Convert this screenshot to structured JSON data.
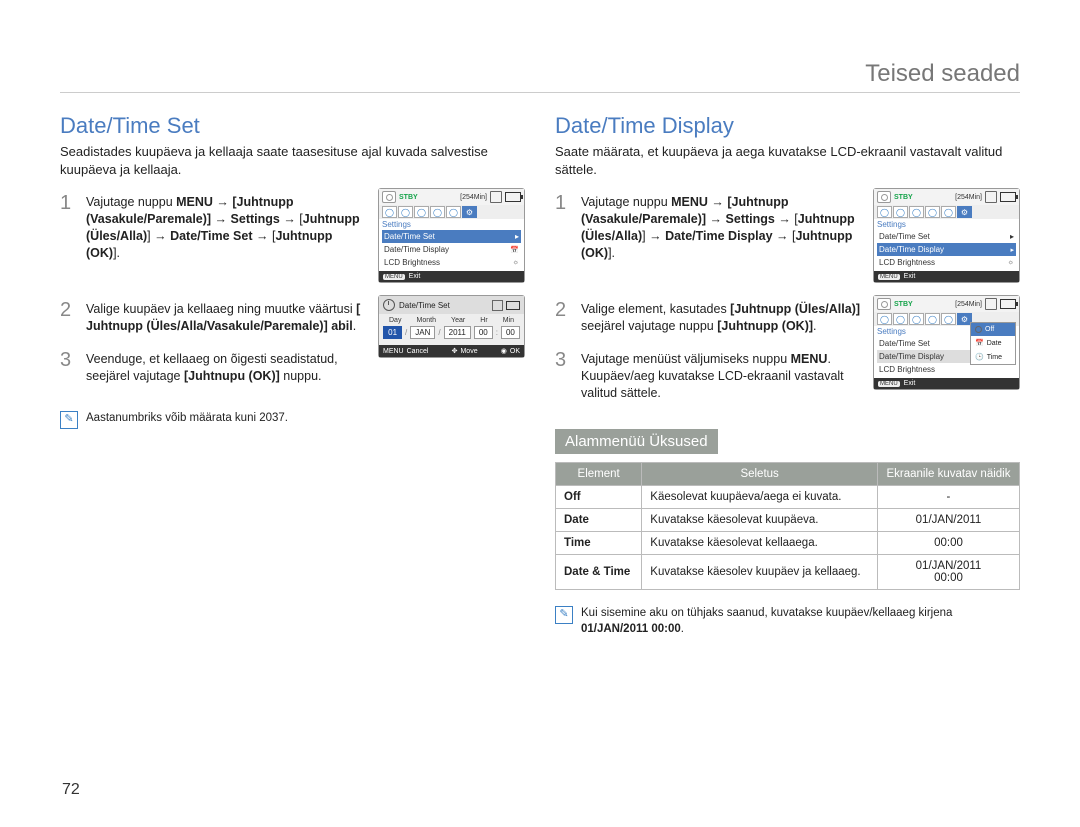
{
  "page": {
    "header": "Teised seaded",
    "number": "72"
  },
  "left": {
    "title": "Date/Time Set",
    "intro": "Seadistades kuupäeva ja kellaaja saate taasesituse ajal kuvada salvestise kuupäeva ja kellaaja.",
    "step1_a": "Vajutage nuppu ",
    "step1_menu": "MENU",
    "step1_b": " → ",
    "step1_c": "[Juhtnupp (Vasakule/Paremale)]",
    "step1_d": " → ",
    "step1_e": "Settings",
    "step1_f": " → [",
    "step1_g": "Juhtnupp (Üles/Alla)",
    "step1_h": "] → ",
    "step1_i": "Date/Time Set",
    "step1_j": " → [",
    "step1_k": "Juhtnupp (OK)",
    "step1_l": "].",
    "step2_a": "Valige kuupäev ja kellaaeg ning muutke väärtusi ",
    "step2_b": "[ Juhtnupp (Üles/Alla/Vasakule/Paremale)] abil",
    "step2_c": ".",
    "step3_a": "Veenduge, et kellaaeg on õigesti seadistatud, seejärel vajutage ",
    "step3_b": "[Juhtnupu (OK)]",
    "step3_c": " nuppu.",
    "note": "Aastanumbriks võib määrata kuni 2037."
  },
  "right": {
    "title": "Date/Time Display",
    "intro": "Saate määrata, et kuupäeva ja aega kuvatakse LCD-ekraanil vastavalt valitud sättele.",
    "step1_a": "Vajutage nuppu ",
    "step1_menu": "MENU",
    "step1_b": " → ",
    "step1_c": "[Juhtnupp (Vasakule/Paremale)]",
    "step1_d": " → ",
    "step1_e": "Settings",
    "step1_f": " → [",
    "step1_g": "Juhtnupp (Üles/Alla)",
    "step1_h": "] → ",
    "step1_i": "Date/Time Display",
    "step1_j": " → [",
    "step1_k": "Juhtnupp (OK)",
    "step1_l": "].",
    "step2_a": "Valige element, kasutades ",
    "step2_b": "[Juhtnupp (Üles/Alla)]",
    "step2_c": " seejärel vajutage nuppu ",
    "step2_d": "[Juhtnupp (OK)]",
    "step2_e": ".",
    "step3_a": "Vajutage menüüst väljumiseks nuppu ",
    "step3_b": "MENU",
    "step3_c": ".",
    "step3_d": "Kuupäev/aeg kuvatakse LCD-ekraanil vastavalt valitud sättele.",
    "submenu_label": "Alammenüü Üksused",
    "table": {
      "h1": "Element",
      "h2": "Seletus",
      "h3": "Ekraanile kuvatav näidik",
      "r1c1": "Off",
      "r1c2": "Käesolevat kuupäeva/aega ei kuvata.",
      "r1c3": "-",
      "r2c1": "Date",
      "r2c2": "Kuvatakse käesolevat kuupäeva.",
      "r2c3": "01/JAN/2011",
      "r3c1": "Time",
      "r3c2": "Kuvatakse käesolevat kellaaega.",
      "r3c3": "00:00",
      "r4c1": "Date & Time",
      "r4c2": "Kuvatakse käesolev kuupäev ja kellaaeg.",
      "r4c3a": "01/JAN/2011",
      "r4c3b": "00:00"
    },
    "note_a": "Kui sisemine aku on tühjaks saanud, kuvatakse kuupäev/kellaaeg kirjena ",
    "note_b": "01/JAN/2011 00:00",
    "note_c": "."
  },
  "lcd": {
    "stby": "STBY",
    "min": "[254Min]",
    "settings": "Settings",
    "dtset": "Date/Time Set",
    "dtdisp": "Date/Time Display",
    "lcdb": "LCD Brightness",
    "exit": "Exit",
    "menu_tag": "MENU",
    "cancel": "Cancel",
    "move": "Move",
    "ok": "OK",
    "day": "Day",
    "month": "Month",
    "year": "Year",
    "hr": "Hr",
    "minlbl": "Min",
    "v_day": "01",
    "v_mon": "JAN",
    "v_year": "2011",
    "v_hr": "00",
    "v_min": "00",
    "off": "Off",
    "date": "Date",
    "time": "Time"
  }
}
